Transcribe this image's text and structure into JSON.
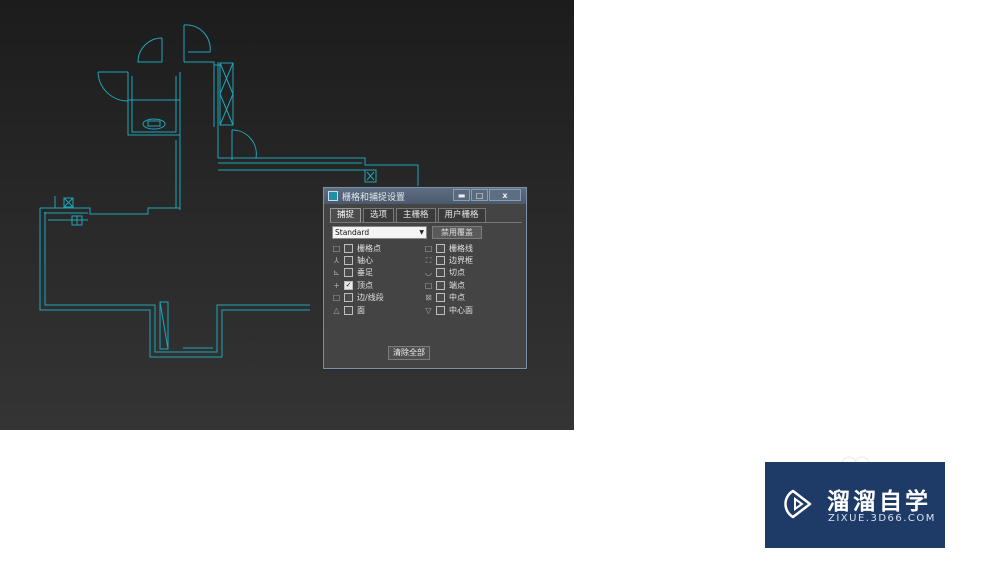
{
  "dialog": {
    "title": "栅格和捕捉设置",
    "window_buttons": {
      "minimize": "▬",
      "maximize": "□",
      "close": "x"
    },
    "tabs": [
      {
        "label": "捕捉",
        "active": true
      },
      {
        "label": "选项",
        "active": false
      },
      {
        "label": "主栅格",
        "active": false
      },
      {
        "label": "用户栅格",
        "active": false
      }
    ],
    "snap_preset": "Standard",
    "override_button": "禁用覆盖",
    "left_options": [
      {
        "icon": "grid-point-icon",
        "glyph": "□",
        "label": "栅格点",
        "checked": false
      },
      {
        "icon": "pivot-icon",
        "glyph": "⅄",
        "label": "轴心",
        "checked": false
      },
      {
        "icon": "perpendicular-icon",
        "glyph": "⊾",
        "label": "垂足",
        "checked": false
      },
      {
        "icon": "vertex-icon",
        "glyph": "+",
        "label": "顶点",
        "checked": true
      },
      {
        "icon": "edge-segment-icon",
        "glyph": "□",
        "label": "边/线段",
        "checked": false
      },
      {
        "icon": "face-icon",
        "glyph": "△",
        "label": "面",
        "checked": false
      }
    ],
    "right_options": [
      {
        "icon": "grid-line-icon",
        "glyph": "□",
        "label": "栅格线",
        "checked": false
      },
      {
        "icon": "bounding-box-icon",
        "glyph": "⛶",
        "label": "边界框",
        "checked": false
      },
      {
        "icon": "tangent-icon",
        "glyph": "◡",
        "label": "切点",
        "checked": false
      },
      {
        "icon": "endpoint-icon",
        "glyph": "□",
        "label": "端点",
        "checked": false
      },
      {
        "icon": "midpoint-icon",
        "glyph": "⊠",
        "label": "中点",
        "checked": false
      },
      {
        "icon": "center-face-icon",
        "glyph": "▽",
        "label": "中心面",
        "checked": false
      }
    ],
    "clear_all": "清除全部"
  },
  "logo": {
    "cn": "溜溜自学",
    "en": "ZIXUE.3D66.COM"
  },
  "colors": {
    "plan_line": "#1fa5b8",
    "dialog_bg": "#444444",
    "logo_bg": "#1e3b67"
  }
}
